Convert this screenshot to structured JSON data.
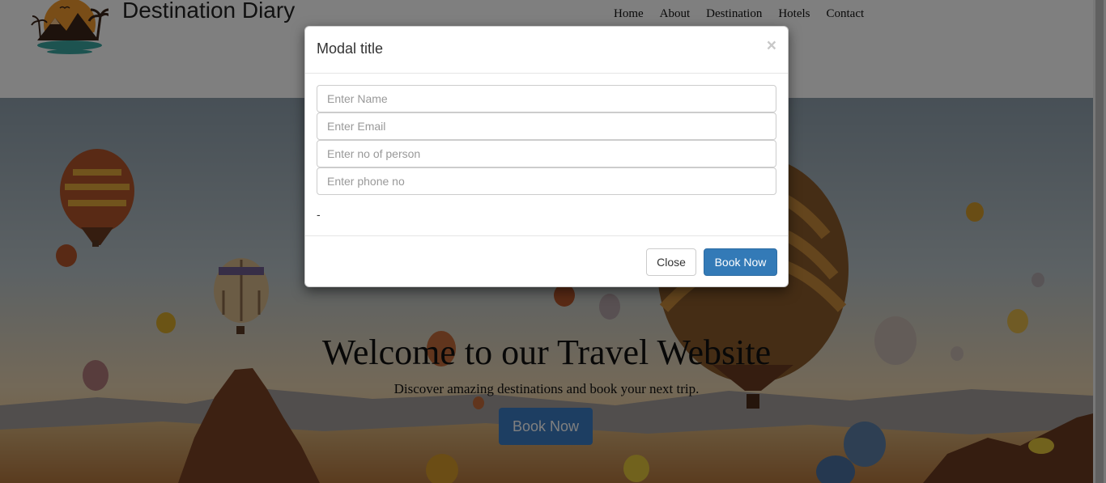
{
  "site": {
    "title": "Destination Diary"
  },
  "nav": {
    "items": [
      "Home",
      "About",
      "Destination",
      "Hotels",
      "Contact"
    ]
  },
  "hero": {
    "title": "Welcome to our Travel Website",
    "subtitle": "Discover amazing destinations and book your next trip.",
    "button_label": "Book Now"
  },
  "modal": {
    "title": "Modal title",
    "close_symbol": "×",
    "fields": {
      "name_placeholder": "Enter Name",
      "email_placeholder": "Enter Email",
      "persons_placeholder": "Enter no of person",
      "phone_placeholder": "Enter phone no"
    },
    "dash_text": "-",
    "close_label": "Close",
    "book_label": "Book Now"
  },
  "colors": {
    "primary_button": "#337ab7",
    "hero_button": "#3a7cc4",
    "backdrop": "rgba(0,0,0,0.5)"
  },
  "icons": {
    "logo": "sunset-mountains-logo",
    "modal_close": "close-icon"
  }
}
